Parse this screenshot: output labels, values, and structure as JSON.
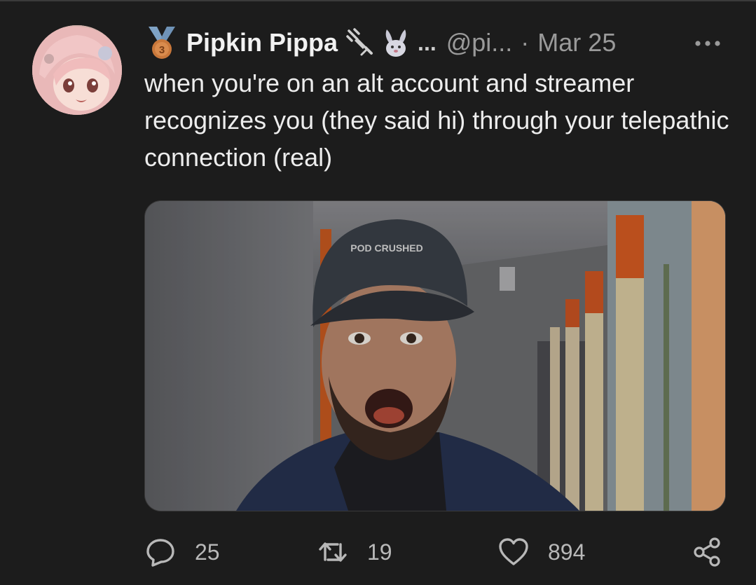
{
  "tweet": {
    "display_name": "Pipkin Pippa",
    "name_overflow": "...",
    "handle": "@pi...",
    "separator": "·",
    "date": "Mar 25",
    "text": "when you're on an alt account and streamer recognizes you (they said hi) through your telepathic connection (real)",
    "medal_rank": "3",
    "media_cap_text": "POD CRUSHED"
  },
  "icons": {
    "medal": "bronze-medal-icon",
    "unplugged": "unplugged-plug-icon",
    "rabbit": "rabbit-icon",
    "more": "more-dots-icon",
    "reply": "reply-bubble-icon",
    "retweet": "retweet-icon",
    "like": "heart-icon",
    "share": "share-icon"
  },
  "actions": {
    "reply_count": "25",
    "retweet_count": "19",
    "like_count": "894"
  },
  "colors": {
    "background": "#1c1c1c",
    "text": "#ededed",
    "muted": "#9a9a9a",
    "medal_bronze": "#c8773a",
    "medal_ribbon": "#7fa3c6"
  }
}
